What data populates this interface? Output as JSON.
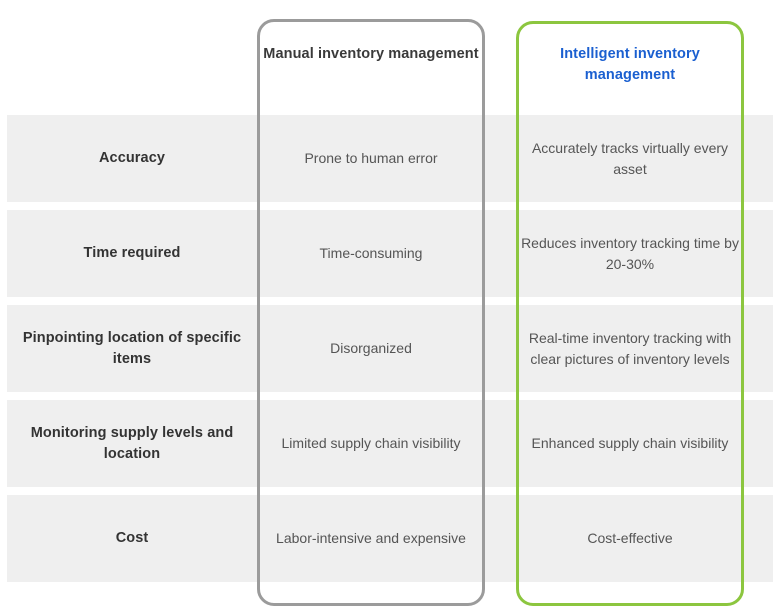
{
  "table": {
    "columns": [
      {
        "key": "criterion",
        "header": ""
      },
      {
        "key": "manual",
        "header": "Manual inventory management"
      },
      {
        "key": "intelligent",
        "header": "Intelligent inventory management"
      }
    ],
    "rows": [
      {
        "criterion": "Accuracy",
        "manual": "Prone to human error",
        "intelligent": "Accurately tracks virtually every asset"
      },
      {
        "criterion": "Time required",
        "manual": "Time-consuming",
        "intelligent": "Reduces inventory tracking time by 20-30%"
      },
      {
        "criterion": "Pinpointing location of specific items",
        "manual": "Disorganized",
        "intelligent": "Real-time inventory tracking with clear pictures of inventory levels"
      },
      {
        "criterion": "Monitoring supply levels and location",
        "manual": "Limited supply chain visibility",
        "intelligent": "Enhanced supply chain visibility"
      },
      {
        "criterion": "Cost",
        "manual": "Labor-intensive and expensive",
        "intelligent": "Cost-effective"
      }
    ]
  },
  "colors": {
    "row_band": "#efefef",
    "manual_border": "#9b9b9b",
    "intelligent_border": "#8cc63f",
    "intelligent_header_text": "#1a5fd0",
    "criterion_text": "#333333",
    "body_text": "#555555",
    "background": "#ffffff"
  }
}
